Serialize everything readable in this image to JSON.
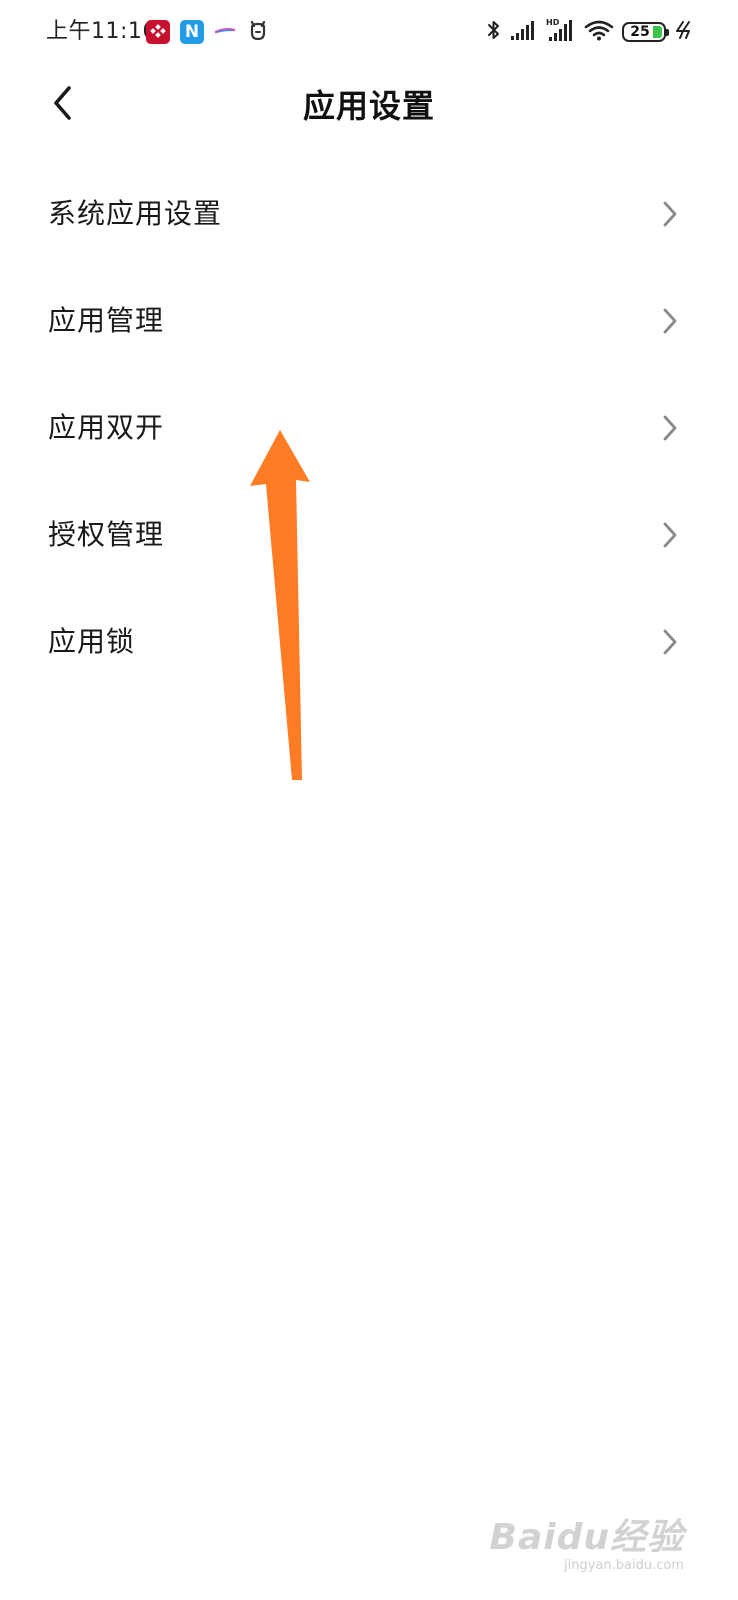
{
  "status_bar": {
    "time": "上午11:16",
    "battery": "25",
    "colors": {
      "text": "#222222",
      "battery_fill": "#3cc34a",
      "app_red": "#c8102e",
      "app_blue": "#1f9be8"
    },
    "notification_icons": [
      "app-red-checker-icon",
      "app-n-icon",
      "app-feather-icon",
      "app-mascot-icon"
    ],
    "system_icons": [
      "bluetooth-icon",
      "signal-icon",
      "hd-signal-icon",
      "wifi-icon",
      "battery-icon",
      "charging-icon"
    ]
  },
  "header": {
    "title": "应用设置",
    "back_icon": "chevron-left-icon"
  },
  "settings": {
    "items": [
      {
        "label": "系统应用设置"
      },
      {
        "label": "应用管理"
      },
      {
        "label": "应用双开"
      },
      {
        "label": "授权管理"
      },
      {
        "label": "应用锁"
      }
    ],
    "chevron_icon": "chevron-right-icon",
    "chevron_color": "#8a8a8a"
  },
  "annotation": {
    "type": "arrow",
    "color": "#ff7b24",
    "points_to": "应用双开"
  },
  "watermark": {
    "logo": "Baidu经验",
    "url": "jingyan.baidu.com"
  }
}
